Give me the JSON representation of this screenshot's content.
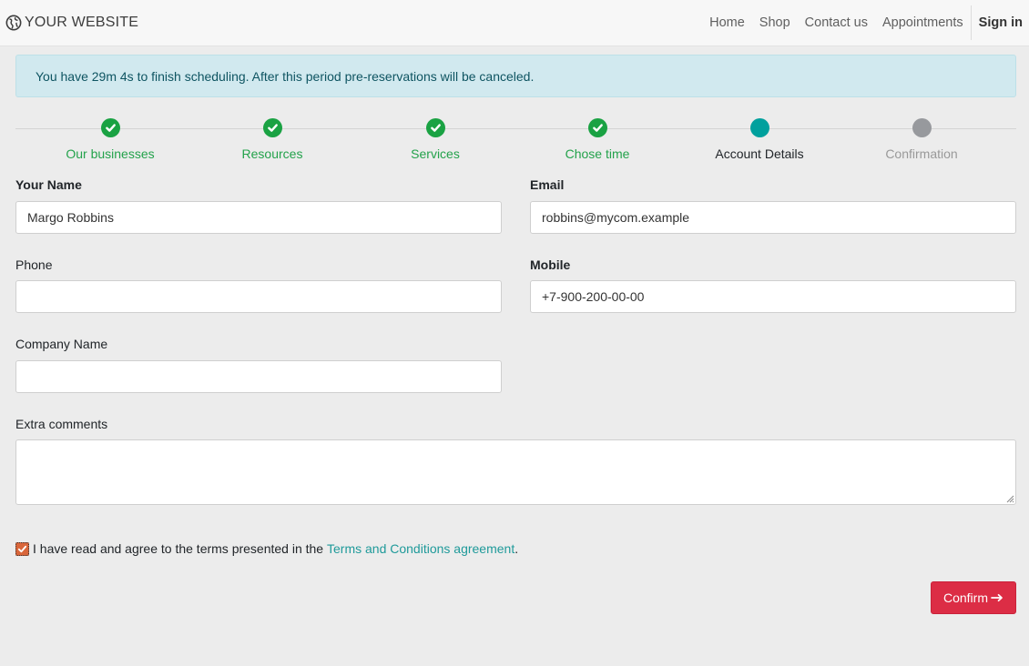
{
  "header": {
    "brand": "YOUR WEBSITE",
    "brand_icon": "globe-icon",
    "nav": [
      "Home",
      "Shop",
      "Contact us",
      "Appointments"
    ],
    "sign_in": "Sign in"
  },
  "alert": {
    "text": "You have 29m 4s to finish scheduling. After this period pre-reservations will be canceled."
  },
  "steps": [
    {
      "label": "Our businesses",
      "status": "done"
    },
    {
      "label": "Resources",
      "status": "done"
    },
    {
      "label": "Services",
      "status": "done"
    },
    {
      "label": "Chose time",
      "status": "done"
    },
    {
      "label": "Account Details",
      "status": "active"
    },
    {
      "label": "Confirmation",
      "status": "pending"
    }
  ],
  "form": {
    "name_label": "Your Name",
    "name_value": "Margo Robbins",
    "email_label": "Email",
    "email_value": "robbins@mycom.example",
    "phone_label": "Phone",
    "phone_value": "",
    "mobile_label": "Mobile",
    "mobile_value": "+7-900-200-00-00",
    "company_label": "Company Name",
    "company_value": "",
    "comments_label": "Extra comments",
    "comments_value": ""
  },
  "terms": {
    "checked": true,
    "text": "I have read and agree to the terms presented in the",
    "link": "Terms and Conditions agreement",
    "end": "."
  },
  "confirm_label": "Confirm",
  "colors": {
    "done": "#1aa243",
    "active": "#00a09d",
    "pending": "#97999d",
    "confirm": "#dc2d45",
    "alert_bg": "#d1e9ef",
    "link": "#1f9a9a"
  }
}
